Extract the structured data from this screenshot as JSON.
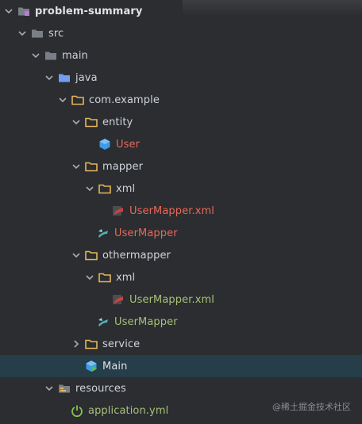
{
  "colors": {
    "background": "#2b2d30",
    "selected_row": "#263d4a",
    "default_text": "#cfd3dc",
    "modified_red": "#e8685a",
    "unversioned_green": "#a7c07a",
    "folder_yellow": "#e5b55b",
    "source_folder_blue": "#6f9ef2",
    "module_purple": "#b57cd6"
  },
  "tree": {
    "project": {
      "label": "problem-summary",
      "icon": "module-folder-icon"
    },
    "src": {
      "label": "src",
      "icon": "folder-icon"
    },
    "main": {
      "label": "main",
      "icon": "folder-icon"
    },
    "java": {
      "label": "java",
      "icon": "source-folder-icon"
    },
    "com_example": {
      "label": "com.example",
      "icon": "package-icon"
    },
    "entity": {
      "label": "entity",
      "icon": "package-icon"
    },
    "user": {
      "label": "User",
      "icon": "class-icon"
    },
    "mapper": {
      "label": "mapper",
      "icon": "package-icon"
    },
    "mapper_xml": {
      "label": "xml",
      "icon": "package-icon"
    },
    "mapper_xml_file": {
      "label": "UserMapper.xml",
      "icon": "mybatis-xml-icon"
    },
    "mapper_interface": {
      "label": "UserMapper",
      "icon": "mybatis-interface-icon"
    },
    "othermapper": {
      "label": "othermapper",
      "icon": "package-icon"
    },
    "othermapper_xml": {
      "label": "xml",
      "icon": "package-icon"
    },
    "othermapper_xml_file": {
      "label": "UserMapper.xml",
      "icon": "mybatis-xml-icon"
    },
    "othermapper_interface": {
      "label": "UserMapper",
      "icon": "mybatis-interface-icon"
    },
    "service": {
      "label": "service",
      "icon": "package-icon"
    },
    "main_class": {
      "label": "Main",
      "icon": "main-class-icon"
    },
    "resources": {
      "label": "resources",
      "icon": "resources-folder-icon"
    },
    "application_yml": {
      "label": "application.yml",
      "icon": "spring-config-icon"
    }
  },
  "watermark": "@稀土掘金技术社区"
}
